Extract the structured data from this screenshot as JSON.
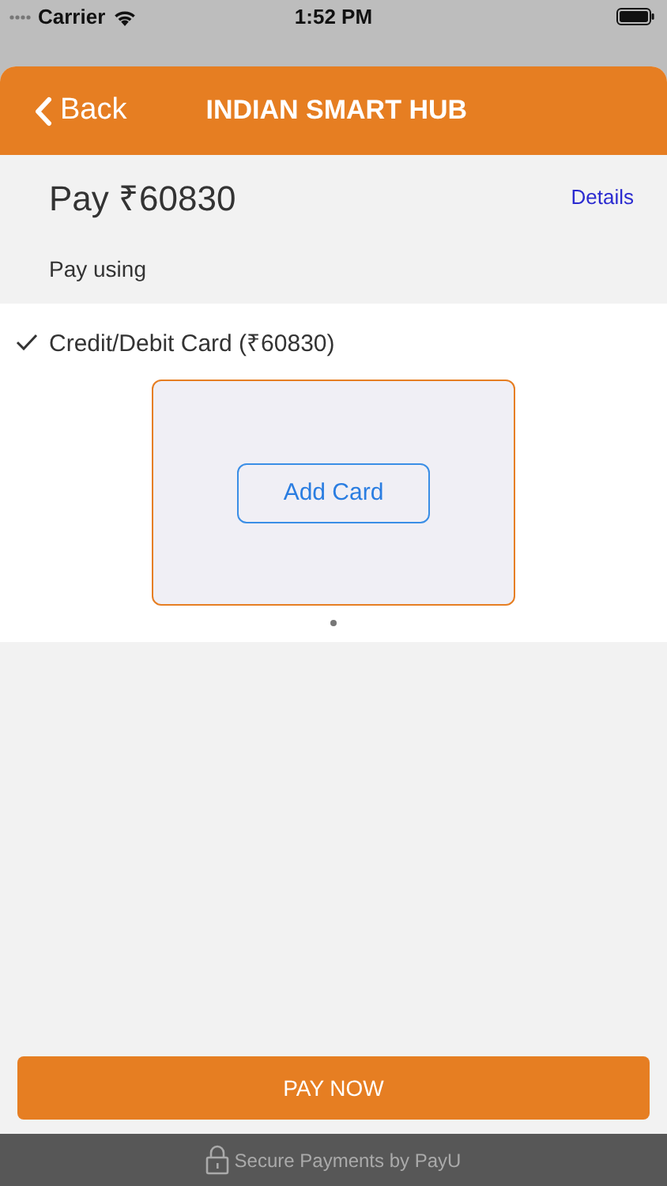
{
  "status_bar": {
    "carrier": "Carrier",
    "time": "1:52 PM"
  },
  "header": {
    "back_label": "Back",
    "title": "INDIAN SMART HUB"
  },
  "amount": {
    "label": "Pay ₹60830",
    "details_link": "Details"
  },
  "section_label": "Pay using",
  "payment_options": [
    {
      "label": "Credit/Debit Card (₹60830)",
      "selected": true
    }
  ],
  "card": {
    "button": "Add Card"
  },
  "pager": [
    {
      "selected": true
    }
  ],
  "pay_button": "PAY NOW",
  "footer": "Secure Payments by PayU"
}
